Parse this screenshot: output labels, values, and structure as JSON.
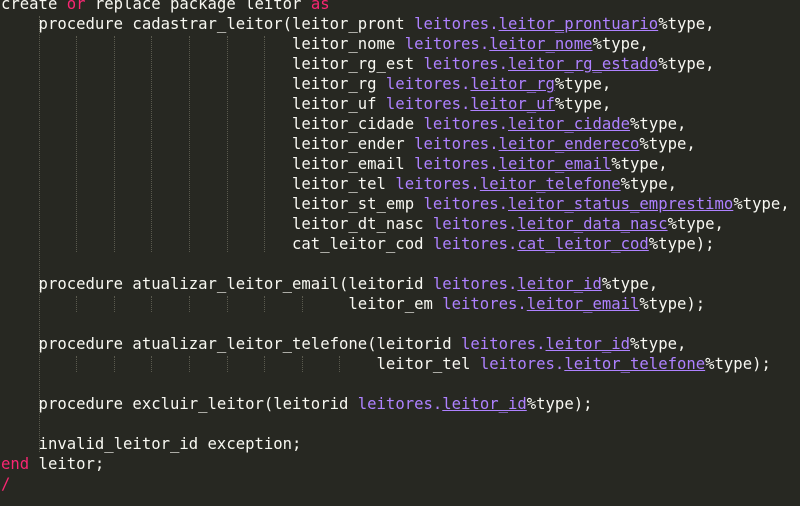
{
  "colors": {
    "background": "#272822",
    "text": "#f8f8f2",
    "keyword": "#f92672",
    "reference": "#ae81ff"
  },
  "lines": [
    [
      {
        "t": "create ",
        "c": "plain"
      },
      {
        "t": "or",
        "c": "kw"
      },
      {
        "t": " replace package leitor ",
        "c": "plain"
      },
      {
        "t": "as",
        "c": "kw"
      }
    ],
    [
      {
        "t": "    procedure cadastrar_leitor(leitor_pront ",
        "c": "plain"
      },
      {
        "t": "leitores",
        "c": "tbl"
      },
      {
        "t": ".",
        "c": "dot"
      },
      {
        "t": "leitor_prontuario",
        "c": "col"
      },
      {
        "t": "%type,",
        "c": "plain"
      }
    ],
    [
      {
        "t": "                               leitor_nome ",
        "c": "plain"
      },
      {
        "t": "leitores",
        "c": "tbl"
      },
      {
        "t": ".",
        "c": "dot"
      },
      {
        "t": "leitor_nome",
        "c": "col"
      },
      {
        "t": "%type,",
        "c": "plain"
      }
    ],
    [
      {
        "t": "                               leitor_rg_est ",
        "c": "plain"
      },
      {
        "t": "leitores",
        "c": "tbl"
      },
      {
        "t": ".",
        "c": "dot"
      },
      {
        "t": "leitor_rg_estado",
        "c": "col"
      },
      {
        "t": "%type,",
        "c": "plain"
      }
    ],
    [
      {
        "t": "                               leitor_rg ",
        "c": "plain"
      },
      {
        "t": "leitores",
        "c": "tbl"
      },
      {
        "t": ".",
        "c": "dot"
      },
      {
        "t": "leitor_rg",
        "c": "col"
      },
      {
        "t": "%type,",
        "c": "plain"
      }
    ],
    [
      {
        "t": "                               leitor_uf ",
        "c": "plain"
      },
      {
        "t": "leitores",
        "c": "tbl"
      },
      {
        "t": ".",
        "c": "dot"
      },
      {
        "t": "leitor_uf",
        "c": "col"
      },
      {
        "t": "%type,",
        "c": "plain"
      }
    ],
    [
      {
        "t": "                               leitor_cidade ",
        "c": "plain"
      },
      {
        "t": "leitores",
        "c": "tbl"
      },
      {
        "t": ".",
        "c": "dot"
      },
      {
        "t": "leitor_cidade",
        "c": "col"
      },
      {
        "t": "%type,",
        "c": "plain"
      }
    ],
    [
      {
        "t": "                               leitor_ender ",
        "c": "plain"
      },
      {
        "t": "leitores",
        "c": "tbl"
      },
      {
        "t": ".",
        "c": "dot"
      },
      {
        "t": "leitor_endereco",
        "c": "col"
      },
      {
        "t": "%type,",
        "c": "plain"
      }
    ],
    [
      {
        "t": "                               leitor_email ",
        "c": "plain"
      },
      {
        "t": "leitores",
        "c": "tbl"
      },
      {
        "t": ".",
        "c": "dot"
      },
      {
        "t": "leitor_email",
        "c": "col"
      },
      {
        "t": "%type,",
        "c": "plain"
      }
    ],
    [
      {
        "t": "                               leitor_tel ",
        "c": "plain"
      },
      {
        "t": "leitores",
        "c": "tbl"
      },
      {
        "t": ".",
        "c": "dot"
      },
      {
        "t": "leitor_telefone",
        "c": "col"
      },
      {
        "t": "%type,",
        "c": "plain"
      }
    ],
    [
      {
        "t": "                               leitor_st_emp ",
        "c": "plain"
      },
      {
        "t": "leitores",
        "c": "tbl"
      },
      {
        "t": ".",
        "c": "dot"
      },
      {
        "t": "leitor_status_emprestimo",
        "c": "col"
      },
      {
        "t": "%type,",
        "c": "plain"
      }
    ],
    [
      {
        "t": "                               leitor_dt_nasc ",
        "c": "plain"
      },
      {
        "t": "leitores",
        "c": "tbl"
      },
      {
        "t": ".",
        "c": "dot"
      },
      {
        "t": "leitor_data_nasc",
        "c": "col"
      },
      {
        "t": "%type,",
        "c": "plain"
      }
    ],
    [
      {
        "t": "                               cat_leitor_cod ",
        "c": "plain"
      },
      {
        "t": "leitores",
        "c": "tbl"
      },
      {
        "t": ".",
        "c": "dot"
      },
      {
        "t": "cat_leitor_cod",
        "c": "col"
      },
      {
        "t": "%type);",
        "c": "plain"
      }
    ],
    [],
    [
      {
        "t": "    procedure atualizar_leitor_email(leitorid ",
        "c": "plain"
      },
      {
        "t": "leitores",
        "c": "tbl"
      },
      {
        "t": ".",
        "c": "dot"
      },
      {
        "t": "leitor_id",
        "c": "col"
      },
      {
        "t": "%type,",
        "c": "plain"
      }
    ],
    [
      {
        "t": "                                     leitor_em ",
        "c": "plain"
      },
      {
        "t": "leitores",
        "c": "tbl"
      },
      {
        "t": ".",
        "c": "dot"
      },
      {
        "t": "leitor_email",
        "c": "col"
      },
      {
        "t": "%type);",
        "c": "plain"
      }
    ],
    [],
    [
      {
        "t": "    procedure atualizar_leitor_telefone(leitorid ",
        "c": "plain"
      },
      {
        "t": "leitores",
        "c": "tbl"
      },
      {
        "t": ".",
        "c": "dot"
      },
      {
        "t": "leitor_id",
        "c": "col"
      },
      {
        "t": "%type,",
        "c": "plain"
      }
    ],
    [
      {
        "t": "                                        leitor_tel ",
        "c": "plain"
      },
      {
        "t": "leitores",
        "c": "tbl"
      },
      {
        "t": ".",
        "c": "dot"
      },
      {
        "t": "leitor_telefone",
        "c": "col"
      },
      {
        "t": "%type);",
        "c": "plain"
      }
    ],
    [],
    [
      {
        "t": "    procedure excluir_leitor(leitorid ",
        "c": "plain"
      },
      {
        "t": "leitores",
        "c": "tbl"
      },
      {
        "t": ".",
        "c": "dot"
      },
      {
        "t": "leitor_id",
        "c": "col"
      },
      {
        "t": "%type);",
        "c": "plain"
      }
    ],
    [],
    [
      {
        "t": "    invalid_leitor_id exception;",
        "c": "plain"
      }
    ],
    [
      {
        "t": "end",
        "c": "kw"
      },
      {
        "t": " leitor;",
        "c": "plain"
      }
    ],
    [
      {
        "t": "/",
        "c": "kw"
      }
    ]
  ]
}
